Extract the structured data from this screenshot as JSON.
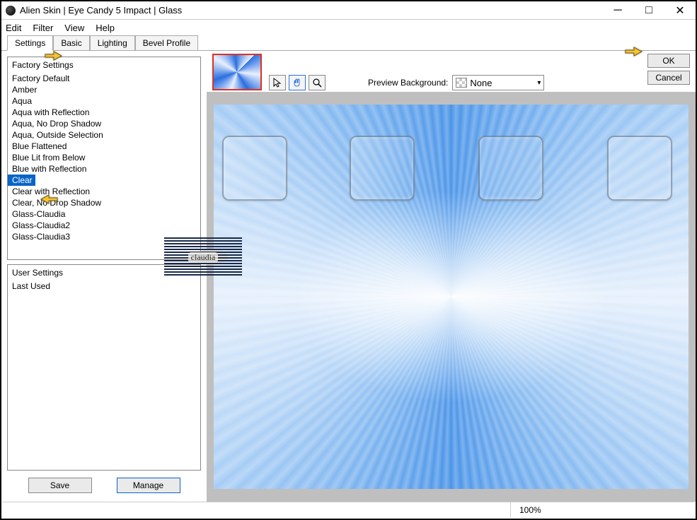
{
  "window": {
    "title": "Alien Skin | Eye Candy 5 Impact | Glass"
  },
  "menu": {
    "edit": "Edit",
    "filter": "Filter",
    "view": "View",
    "help": "Help"
  },
  "tabs": {
    "settings": "Settings",
    "basic": "Basic",
    "lighting": "Lighting",
    "bevel": "Bevel Profile"
  },
  "factory": {
    "header": "Factory Settings",
    "items": [
      "Factory Default",
      "Amber",
      "Aqua",
      "Aqua with Reflection",
      "Aqua, No Drop Shadow",
      "Aqua, Outside Selection",
      "Blue Flattened",
      "Blue Lit from Below",
      "Blue with Reflection",
      "Clear",
      "Clear with Reflection",
      "Clear, No Drop Shadow",
      "Glass-Claudia",
      "Glass-Claudia2",
      "Glass-Claudia3"
    ],
    "selected_index": 9
  },
  "user": {
    "header": "User Settings",
    "items": [
      "Last Used"
    ]
  },
  "buttons": {
    "save": "Save",
    "manage": "Manage",
    "ok": "OK",
    "cancel": "Cancel"
  },
  "preview": {
    "label": "Preview Background:",
    "value": "None"
  },
  "status": {
    "zoom": "100%"
  },
  "watermark": "claudia"
}
